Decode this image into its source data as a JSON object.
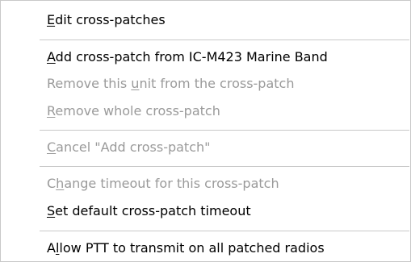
{
  "menu": {
    "items": [
      {
        "pre": "",
        "key": "E",
        "post": "dit cross-patches",
        "enabled": true
      },
      {
        "pre": "",
        "key": "A",
        "post": "dd cross-patch from IC-M423   Marine Band",
        "enabled": true
      },
      {
        "pre": "Remove this ",
        "key": "u",
        "post": "nit from the cross-patch",
        "enabled": false
      },
      {
        "pre": "",
        "key": "R",
        "post": "emove whole cross-patch",
        "enabled": false
      },
      {
        "pre": "",
        "key": "C",
        "post": "ancel \"Add cross-patch\"",
        "enabled": false
      },
      {
        "pre": "C",
        "key": "h",
        "post": "ange timeout for this cross-patch",
        "enabled": false
      },
      {
        "pre": "",
        "key": "S",
        "post": "et default cross-patch timeout",
        "enabled": true
      },
      {
        "pre": "A",
        "key": "l",
        "post": "low PTT to transmit on all patched radios",
        "enabled": true
      }
    ]
  }
}
